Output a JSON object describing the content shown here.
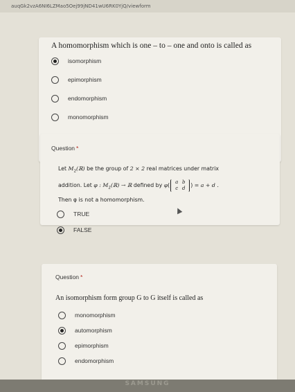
{
  "browser": {
    "url": "auqGk2vzA6NI6LZMao5Oej99jND41wU6RK0YjQ/viewform"
  },
  "q1": {
    "prompt": "A homomorphism which is one – to – one and onto is called as",
    "options": [
      {
        "label": "isomorphism",
        "selected": true
      },
      {
        "label": "epimorphism",
        "selected": false
      },
      {
        "label": "endomorphism",
        "selected": false
      },
      {
        "label": "monomorphism",
        "selected": false
      }
    ]
  },
  "q2": {
    "label": "Question",
    "required_mark": "*",
    "line1_a": "Let ",
    "line1_m": "M",
    "line1_sub": "2",
    "line1_r": "(ℝ)",
    "line1_b": " be the group of ",
    "line1_dim": "2 × 2",
    "line1_c": " real matrices under matrix",
    "line2_a": "addition. Let ",
    "line2_phi_map": "φ : M",
    "line2_sub": "2",
    "line2_map_rest": "(ℝ) → ℝ",
    "line2_b": " defined by ",
    "line2_phi": "φ",
    "m_a": "a",
    "m_b": "b",
    "m_c": "c",
    "m_d": "d",
    "line2_result": " = a + d .",
    "line3": "Then φ is not a homomorphism.",
    "options": [
      {
        "label": "TRUE",
        "selected": false
      },
      {
        "label": "FALSE",
        "selected": true
      }
    ]
  },
  "q3": {
    "label": "Question",
    "required_mark": "*",
    "prompt": "An isomorphism form group G to G itself is called as",
    "options": [
      {
        "label": "monomorphism",
        "selected": false
      },
      {
        "label": "automorphism",
        "selected": true
      },
      {
        "label": "epimorphism",
        "selected": false
      },
      {
        "label": "endomorphism",
        "selected": false
      }
    ]
  },
  "device": {
    "brand": "SAMSUNG"
  }
}
